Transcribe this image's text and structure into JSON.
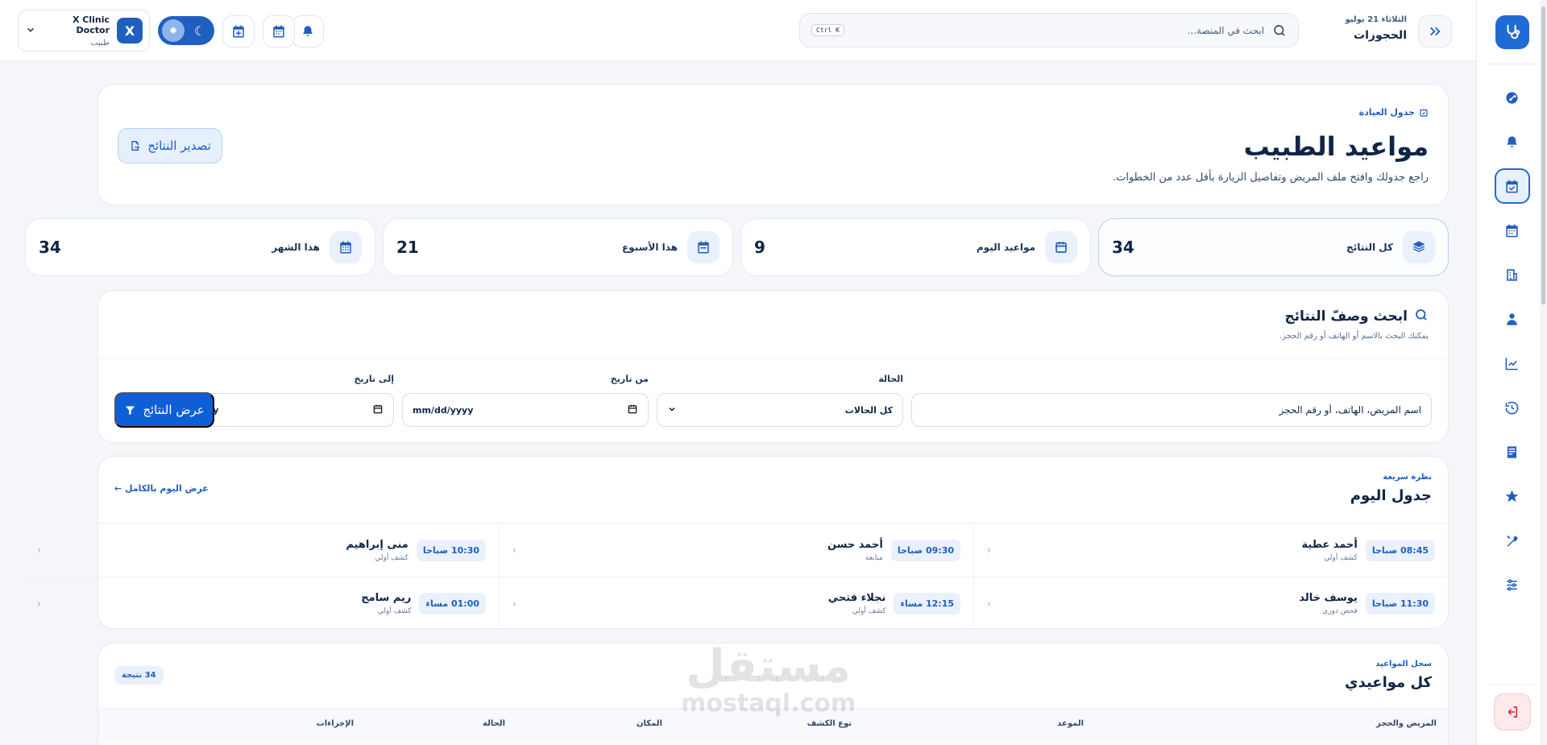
{
  "topbar": {
    "date": "الثلاثاء 21 يوليو",
    "page_title": "الحجوزات",
    "search_placeholder": "ابحث في المنصة...",
    "shortcut": "Ctrl K"
  },
  "user": {
    "name": "X Clinic Doctor",
    "role": "طبيب",
    "initial": "X"
  },
  "hero": {
    "eyebrow": "جدول العيادة",
    "title": "مواعيد الطبيب",
    "description": "راجع جدولك وافتح ملف المريض وتفاصيل الزيارة بأقل عدد من الخطوات.",
    "export_label": "تصدير النتائج"
  },
  "stats": [
    {
      "label": "كل النتائج",
      "value": "34",
      "icon": "layers-icon"
    },
    {
      "label": "مواعيد اليوم",
      "value": "9",
      "icon": "calendar-icon"
    },
    {
      "label": "هذا الأسبوع",
      "value": "21",
      "icon": "calendar-week-icon"
    },
    {
      "label": "هذا الشهر",
      "value": "34",
      "icon": "calendar-month-icon"
    }
  ],
  "filters": {
    "title": "ابحث وصفّ النتائج",
    "subtitle": "يمكنك البحث بالاسم أو الهاتف أو رقم الحجز.",
    "search_placeholder": "اسم المريض، الهاتف، أو رقم الحجز",
    "status_label": "الحالة",
    "status_value": "كل الحالات",
    "from_label": "من تاريخ",
    "to_label": "إلى تاريخ",
    "date_placeholder": "mm/dd/yyyy",
    "apply_label": "عرض النتائج"
  },
  "today": {
    "eyebrow": "نظرة سريعة",
    "title": "جدول اليوم",
    "full_day_link": "عرض اليوم بالكامل",
    "appointments": [
      {
        "time": "08:45 صباحا",
        "name": "أحمد عطية",
        "type": "كشف أولي"
      },
      {
        "time": "09:30 صباحا",
        "name": "أحمد حسن",
        "type": "متابعة"
      },
      {
        "time": "10:30 صباحا",
        "name": "منى إبراهيم",
        "type": "كشف أولي"
      },
      {
        "time": "11:30 صباحا",
        "name": "يوسف خالد",
        "type": "فحص دوري"
      },
      {
        "time": "12:15 مساء",
        "name": "نجلاء فتحي",
        "type": "كشف أولي"
      },
      {
        "time": "01:00 مساء",
        "name": "ريم سامح",
        "type": "كشف أولي"
      }
    ]
  },
  "history": {
    "eyebrow": "سجل المواعيد",
    "title": "كل مواعيدي",
    "count_badge": "34 نتيجة",
    "columns": [
      "المريض والحجز",
      "الموعد",
      "نوع الكشف",
      "المكان",
      "الحالة",
      "الإجراءات"
    ]
  },
  "watermark": {
    "arabic": "مستقل",
    "latin": "mostaql.com"
  },
  "colors": {
    "accent": "#1f5fc0",
    "primary_button": "#0d5fd6",
    "danger": "#d93434"
  }
}
